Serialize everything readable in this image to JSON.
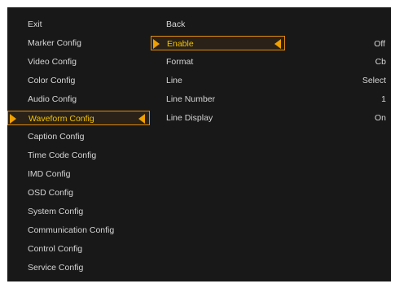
{
  "left_menu": {
    "items": [
      {
        "label": "Exit"
      },
      {
        "label": "Marker Config"
      },
      {
        "label": "Video Config"
      },
      {
        "label": "Color Config"
      },
      {
        "label": "Audio Config"
      },
      {
        "label": "Waveform Config",
        "selected": true
      },
      {
        "label": "Caption Config"
      },
      {
        "label": "Time Code Config"
      },
      {
        "label": "IMD Config"
      },
      {
        "label": "OSD Config"
      },
      {
        "label": "System Config"
      },
      {
        "label": "Communication Config"
      },
      {
        "label": "Control Config"
      },
      {
        "label": "Service Config"
      }
    ]
  },
  "right_menu": {
    "items": [
      {
        "label": "Back",
        "value": ""
      },
      {
        "label": "Enable",
        "value": "Off",
        "selected": true
      },
      {
        "label": "Format",
        "value": "Cb"
      },
      {
        "label": "Line",
        "value": "Select"
      },
      {
        "label": "Line Number",
        "value": "1"
      },
      {
        "label": "Line Display",
        "value": "On"
      }
    ]
  },
  "colors": {
    "background": "#181818",
    "text": "#d6d6d6",
    "selected_text": "#f2c200",
    "selected_border": "#e08a10",
    "arrow": "#f0a000"
  }
}
